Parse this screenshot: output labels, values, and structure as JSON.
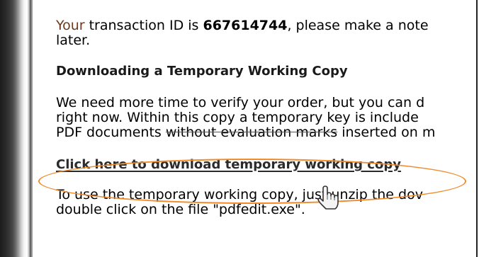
{
  "content": {
    "line1_prefix": "Your",
    "line1_middle": " transaction ID is ",
    "transaction_id": "667614744",
    "line1_suffix": ", please make a note",
    "line2": "later.",
    "heading": "Downloading a Temporary Working Copy",
    "para2_line1": "We need more time to verify your order, but you can d",
    "para2_line2": "right now. Within this copy a temporary key is include",
    "para2_line3_start": "PDF documents ",
    "para2_line3_strike": "without evaluation marks",
    "para2_line3_end": " inserted on m",
    "download_link": "Click here to download temporary working copy",
    "para3_line1": "To use the temporary working copy, just unzip the dov",
    "para3_line2": "double click on the file \"pdfedit.exe\"."
  },
  "colors": {
    "highlight": "#f08a2a",
    "accent_word": "#6b3a1f"
  },
  "icons": {
    "cursor": "hand-pointer-icon"
  }
}
